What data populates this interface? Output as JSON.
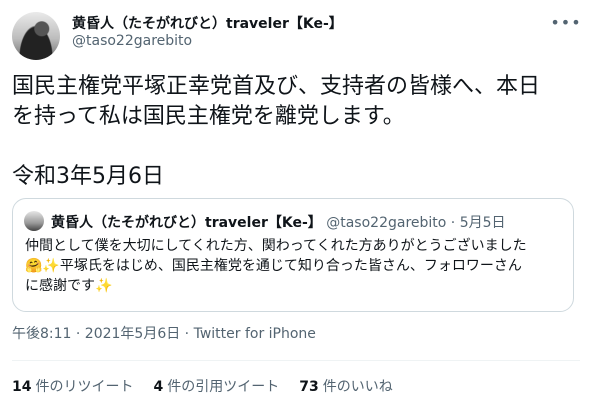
{
  "author": {
    "display_name": "黄昏人（たそがれびと）traveler【Ke-】",
    "handle": "@taso22garebito"
  },
  "more_icon": "ellipsis-icon",
  "tweet": {
    "text": "国民主権党平塚正幸党首及び、支持者の皆様へ、本日\nを持って私は国民主権党を離党します。\n\n令和3年5月6日"
  },
  "quoted_tweet": {
    "display_name": "黄昏人（たそがれびと）traveler【Ke-】",
    "handle": "@taso22garebito",
    "separator": "·",
    "date": "5月5日",
    "text": "仲間として僕を大切にしてくれた方、関わってくれた方ありがとうございました\n🤗✨平塚氏をはじめ、国民主権党を通じて知り合った皆さん、フォロワーさん\nに感謝です✨"
  },
  "timestamp": "午後8:11 · 2021年5月6日 · Twitter for iPhone",
  "stats": {
    "retweets": {
      "count": "14",
      "label": "件のリツイート"
    },
    "quotes": {
      "count": "4",
      "label": "件の引用ツイート"
    },
    "likes": {
      "count": "73",
      "label": "件のいいね"
    }
  }
}
